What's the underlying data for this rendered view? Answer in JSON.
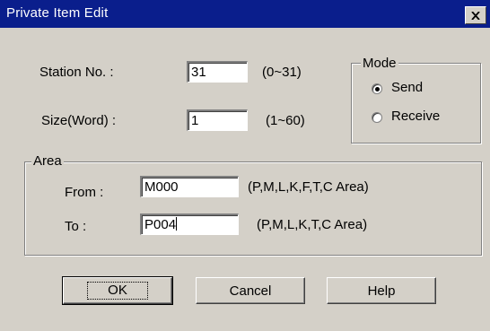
{
  "window": {
    "title": "Private Item Edit"
  },
  "station": {
    "label": "Station No. :",
    "value": "31",
    "range": "(0~31)"
  },
  "size": {
    "label": "Size(Word) :",
    "value": "1",
    "range": "(1~60)"
  },
  "mode": {
    "title": "Mode",
    "options": [
      {
        "label": "Send",
        "selected": true
      },
      {
        "label": "Receive",
        "selected": false
      }
    ]
  },
  "area": {
    "title": "Area",
    "from": {
      "label": "From :",
      "value": "M000",
      "hint": "(P,M,L,K,F,T,C Area)"
    },
    "to": {
      "label": "To :",
      "value": "P004",
      "hint": "(P,M,L,K,T,C Area)"
    }
  },
  "buttons": {
    "ok": "OK",
    "cancel": "Cancel",
    "help": "Help"
  },
  "icons": {
    "close": "close-icon"
  },
  "colors": {
    "titlebar": "#0a1e8c",
    "dialog_bg": "#d4d0c8"
  }
}
